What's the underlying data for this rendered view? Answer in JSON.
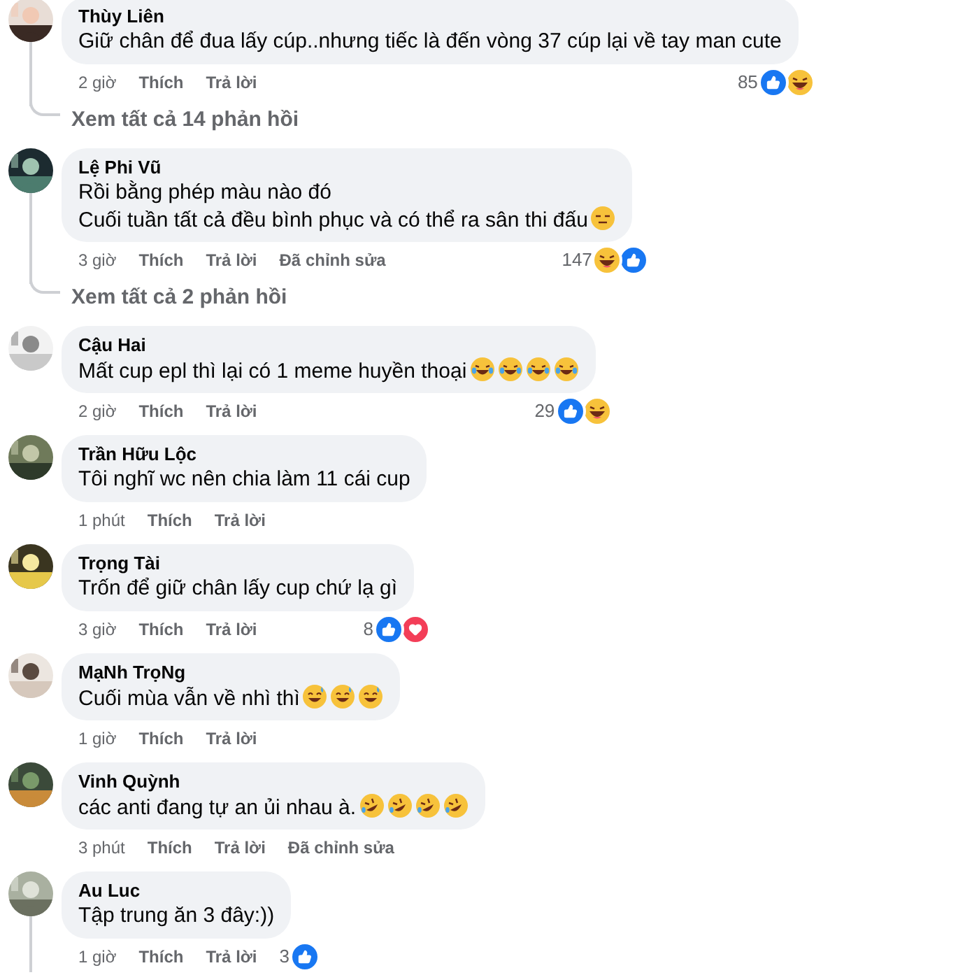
{
  "comments": [
    {
      "name": "Thùy Liên",
      "lines": [
        "Giữ chân để đua lấy cúp..nhưng tiếc là đến vòng 37 cúp lại về tay man cute"
      ],
      "time": "2 giờ",
      "like": "Thích",
      "reply": "Trả lời",
      "count": "85",
      "reactions": [
        {
          "kind": "like"
        },
        {
          "kind": "haha"
        }
      ],
      "replies_link": "Xem tất cả 14 phản hồi"
    },
    {
      "name": "Lệ Phi Vũ",
      "lines": [
        "Rồi bằng phép màu nào đó",
        "Cuối tuần tất cả đều bình phục và có thể ra sân thi đấu"
      ],
      "emojis": [
        {
          "kind": "expressionless"
        }
      ],
      "time": "3 giờ",
      "like": "Thích",
      "reply": "Trả lời",
      "edited": "Đã chỉnh sửa",
      "count": "147",
      "reactions": [
        {
          "kind": "haha"
        },
        {
          "kind": "like"
        }
      ],
      "replies_link": "Xem tất cả 2 phản hồi"
    },
    {
      "name": "Cậu Hai",
      "lines": [
        "Mất cup epl thì lại có 1 meme huyền thoại"
      ],
      "emojis": [
        {
          "kind": "tears"
        },
        {
          "kind": "tears"
        },
        {
          "kind": "tears"
        },
        {
          "kind": "tears"
        }
      ],
      "time": "2 giờ",
      "like": "Thích",
      "reply": "Trả lời",
      "count": "29",
      "reactions": [
        {
          "kind": "like"
        },
        {
          "kind": "haha"
        }
      ]
    },
    {
      "name": "Trần Hữu Lộc",
      "lines": [
        "Tôi nghĩ wc nên chia làm 11 cái cup"
      ],
      "time": "1 phút",
      "like": "Thích",
      "reply": "Trả lời"
    },
    {
      "name": "Trọng Tài",
      "lines": [
        "Trốn để giữ chân lấy cup chứ lạ gì"
      ],
      "time": "3 giờ",
      "like": "Thích",
      "reply": "Trả lời",
      "count": "8",
      "reactions": [
        {
          "kind": "like"
        },
        {
          "kind": "love"
        }
      ]
    },
    {
      "name": "MạNh TrọNg",
      "lines": [
        "Cuối mùa vẫn về nhì thì"
      ],
      "emojis": [
        {
          "kind": "sweat"
        },
        {
          "kind": "sweat"
        },
        {
          "kind": "sweat"
        }
      ],
      "time": "1 giờ",
      "like": "Thích",
      "reply": "Trả lời"
    },
    {
      "name": "Vinh Quỳnh",
      "lines": [
        "các anti đang tự an ủi nhau à."
      ],
      "emojis": [
        {
          "kind": "rofl"
        },
        {
          "kind": "rofl"
        },
        {
          "kind": "rofl"
        },
        {
          "kind": "rofl"
        }
      ],
      "time": "3 phút",
      "like": "Thích",
      "reply": "Trả lời",
      "edited": "Đã chỉnh sửa"
    },
    {
      "name": "Au Luc",
      "lines": [
        "Tập trung ăn 3 đây:))"
      ],
      "time": "1 giờ",
      "like": "Thích",
      "reply": "Trả lời",
      "count": "3",
      "reactions": [
        {
          "kind": "like"
        }
      ],
      "thread": true
    }
  ]
}
